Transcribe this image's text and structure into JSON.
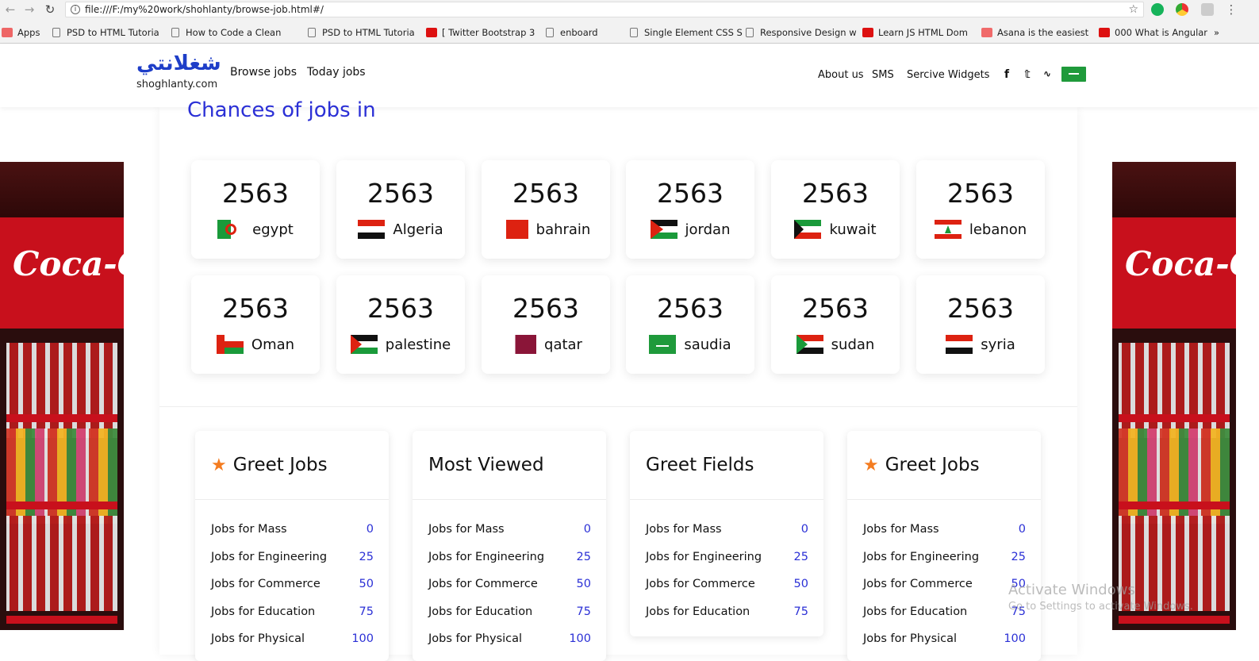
{
  "browser": {
    "url": "file:///F:/my%20work/shohlanty/browse-job.html#/",
    "bookmarks": [
      {
        "label": "Apps",
        "icon": "apps-grid-icon"
      },
      {
        "label": "PSD to HTML Tutoria",
        "icon": "page-icon"
      },
      {
        "label": "How to Code a Clean",
        "icon": "page-icon"
      },
      {
        "label": "PSD to HTML Tutoria",
        "icon": "page-icon"
      },
      {
        "label": "[ Twitter Bootstrap 3",
        "icon": "youtube-icon"
      },
      {
        "label": "enboard",
        "icon": "page-icon"
      },
      {
        "label": "Single Element CSS S",
        "icon": "page-icon"
      },
      {
        "label": "Responsive Design w",
        "icon": "page-icon"
      },
      {
        "label": "Learn JS HTML Dom",
        "icon": "youtube-icon"
      },
      {
        "label": "Asana is the easiest",
        "icon": "asana-icon"
      },
      {
        "label": "000 What is Angular",
        "icon": "youtube-icon"
      }
    ],
    "more": "»"
  },
  "header": {
    "logo_ar": "شغلانتي",
    "logo_en": "shoghlanty.com",
    "nav": [
      "Browse jobs",
      "Today jobs"
    ],
    "right_nav": [
      "About us",
      "SMS",
      "Sercive Widgets"
    ],
    "social": [
      "f",
      "t",
      "rss"
    ]
  },
  "main": {
    "heading": "Chances of jobs in",
    "countries": [
      {
        "count": "2563",
        "name": "egypt"
      },
      {
        "count": "2563",
        "name": "Algeria"
      },
      {
        "count": "2563",
        "name": "bahrain"
      },
      {
        "count": "2563",
        "name": "jordan"
      },
      {
        "count": "2563",
        "name": "kuwait"
      },
      {
        "count": "2563",
        "name": "lebanon"
      },
      {
        "count": "2563",
        "name": "Oman"
      },
      {
        "count": "2563",
        "name": "palestine"
      },
      {
        "count": "2563",
        "name": "qatar"
      },
      {
        "count": "2563",
        "name": "saudia"
      },
      {
        "count": "2563",
        "name": "sudan"
      },
      {
        "count": "2563",
        "name": "syria"
      }
    ],
    "lists": [
      {
        "title": "Greet Jobs",
        "starred": true,
        "items": [
          {
            "label": "Jobs for Mass",
            "count": "0"
          },
          {
            "label": "Jobs for Engineering",
            "count": "25"
          },
          {
            "label": "Jobs for Commerce",
            "count": "50"
          },
          {
            "label": "Jobs for Education",
            "count": "75"
          },
          {
            "label": "Jobs for Physical",
            "count": "100"
          }
        ]
      },
      {
        "title": "Most Viewed",
        "starred": false,
        "items": [
          {
            "label": "Jobs for Mass",
            "count": "0"
          },
          {
            "label": "Jobs for Engineering",
            "count": "25"
          },
          {
            "label": "Jobs for Commerce",
            "count": "50"
          },
          {
            "label": "Jobs for Education",
            "count": "75"
          },
          {
            "label": "Jobs for Physical",
            "count": "100"
          }
        ]
      },
      {
        "title": "Greet Fields",
        "starred": false,
        "items": [
          {
            "label": "Jobs for Mass",
            "count": "0"
          },
          {
            "label": "Jobs for Engineering",
            "count": "25"
          },
          {
            "label": "Jobs for Commerce",
            "count": "50"
          },
          {
            "label": "Jobs for Education",
            "count": "75"
          }
        ]
      },
      {
        "title": "Greet Jobs",
        "starred": true,
        "items": [
          {
            "label": "Jobs for Mass",
            "count": "0"
          },
          {
            "label": "Jobs for Engineering",
            "count": "25"
          },
          {
            "label": "Jobs for Commerce",
            "count": "50"
          },
          {
            "label": "Jobs for Education",
            "count": "75"
          },
          {
            "label": "Jobs for Physical",
            "count": "100"
          }
        ]
      }
    ]
  },
  "ads": {
    "brand": "Coca-Cola"
  },
  "overlay": {
    "line1": "Activate Windows",
    "line2": "Go to Settings to activate Windows."
  },
  "colors": {
    "accent": "#2b30d6",
    "star": "#f47c20",
    "logo": "#1e3ec8"
  }
}
